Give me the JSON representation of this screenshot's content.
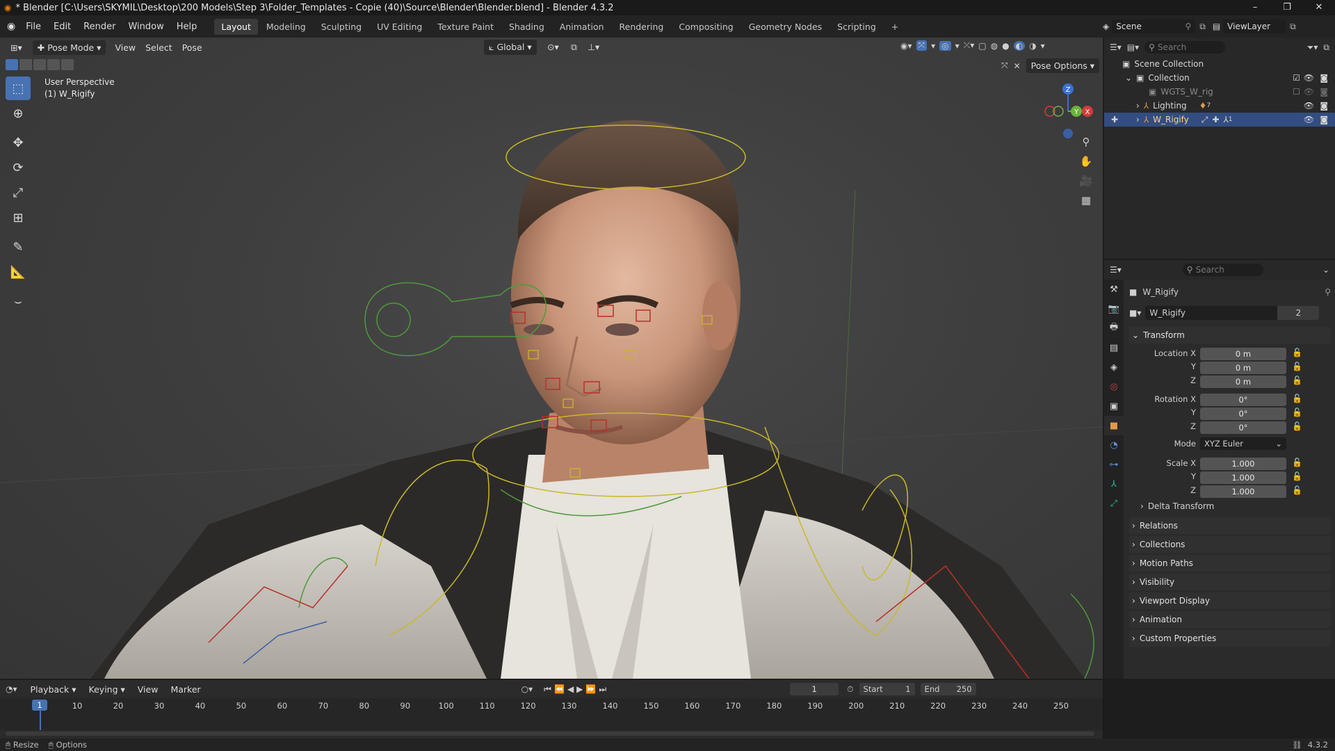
{
  "titlebar": {
    "title": "* Blender [C:\\Users\\SKYMIL\\Desktop\\200 Models\\Step 3\\Folder_Templates - Copie (40)\\Source\\Blender\\Blender.blend] - Blender 4.3.2",
    "minimize": "–",
    "restore": "❐",
    "close": "✕"
  },
  "menu": {
    "items": [
      "File",
      "Edit",
      "Render",
      "Window",
      "Help"
    ]
  },
  "workspaces": {
    "tabs": [
      "Layout",
      "Modeling",
      "Sculpting",
      "UV Editing",
      "Texture Paint",
      "Shading",
      "Animation",
      "Rendering",
      "Compositing",
      "Geometry Nodes",
      "Scripting"
    ],
    "active": "Layout",
    "add": "+"
  },
  "scene": {
    "label": "Scene",
    "view_layer": "ViewLayer"
  },
  "viewport": {
    "mode": "Pose Mode",
    "menus": [
      "View",
      "Select",
      "Pose"
    ],
    "transform_orientation": "Global",
    "pose_options": "Pose Options",
    "overlay_title": "User Perspective",
    "overlay_object": "(1) W_Rigify",
    "gizmo": {
      "z": "Z",
      "y": "Y",
      "x": "X"
    }
  },
  "outliner": {
    "search_placeholder": "Search",
    "rows": [
      {
        "label": "Scene Collection"
      },
      {
        "label": "Collection"
      },
      {
        "label": "WGTS_W_rig"
      },
      {
        "label": "Lighting",
        "badge": "7"
      },
      {
        "label": "W_Rigify",
        "badge": "1"
      }
    ]
  },
  "properties": {
    "search_placeholder": "Search",
    "object_name": "W_Rigify",
    "data_name": "W_Rigify",
    "users": "2",
    "transform_header": "Transform",
    "location_label": "Location X",
    "location": {
      "x": "0 m",
      "y": "0 m",
      "z": "0 m"
    },
    "rotation_label": "Rotation X",
    "rotation": {
      "x": "0°",
      "y": "0°",
      "z": "0°"
    },
    "axis_y": "Y",
    "axis_z": "Z",
    "mode_label": "Mode",
    "mode_value": "XYZ Euler",
    "scale_label": "Scale X",
    "scale": {
      "x": "1.000",
      "y": "1.000",
      "z": "1.000"
    },
    "delta_transform": "Delta Transform",
    "panels": [
      "Relations",
      "Collections",
      "Motion Paths",
      "Visibility",
      "Viewport Display",
      "Animation",
      "Custom Properties"
    ]
  },
  "timeline": {
    "menus": [
      "Playback",
      "Keying",
      "View",
      "Marker"
    ],
    "current_frame": "1",
    "start_label": "Start",
    "start": "1",
    "end_label": "End",
    "end": "250",
    "ticks": [
      "1",
      "10",
      "20",
      "30",
      "40",
      "50",
      "60",
      "70",
      "80",
      "90",
      "100",
      "110",
      "120",
      "130",
      "140",
      "150",
      "160",
      "170",
      "180",
      "190",
      "200",
      "210",
      "220",
      "230",
      "240",
      "250"
    ],
    "playhead": "1"
  },
  "statusbar": {
    "resize": "Resize",
    "options": "Options",
    "version": "4.3.2"
  }
}
